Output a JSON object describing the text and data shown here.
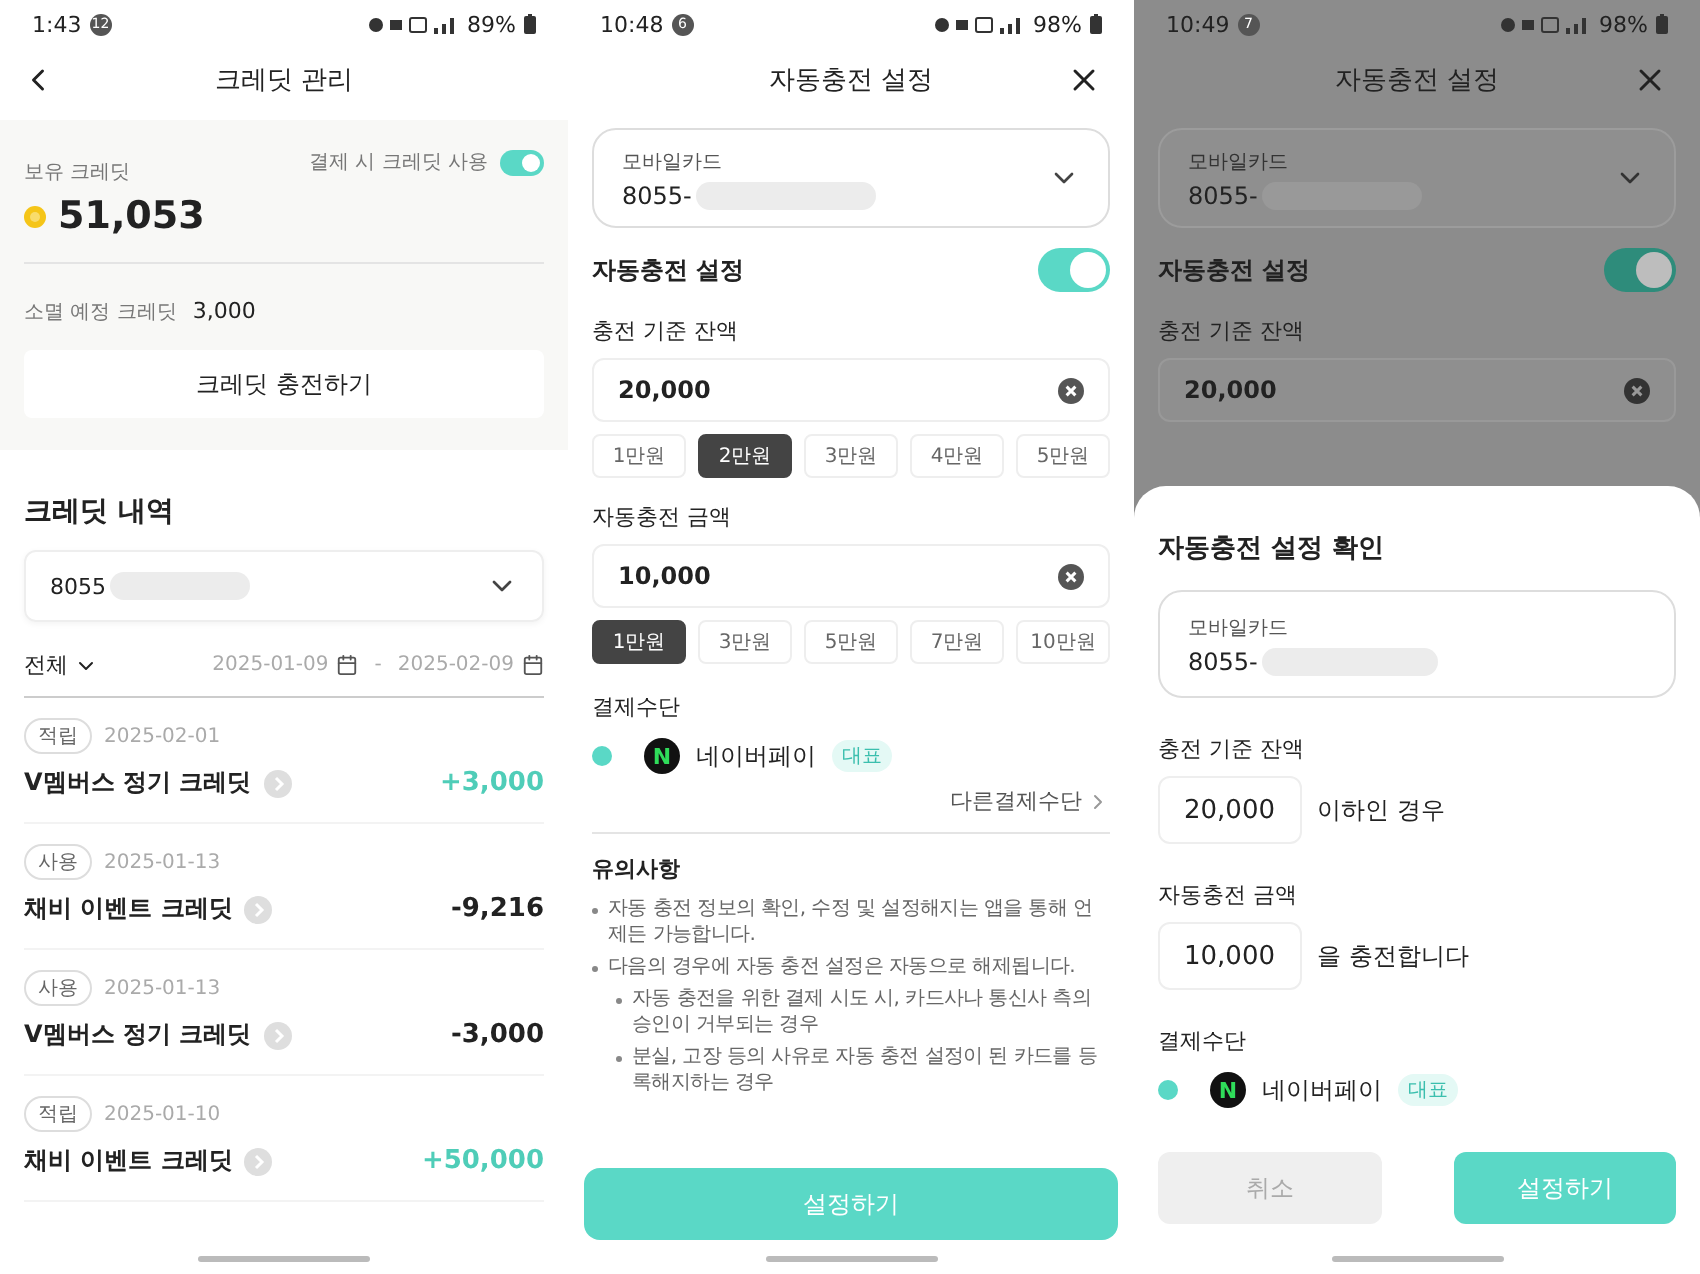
{
  "credit_screen": {
    "status_bar": {
      "time": "1:43",
      "badge": "12",
      "battery": "89%"
    },
    "title": "크레딧 관리",
    "balance_label": "보유 크레딧",
    "balance": "51,053",
    "toggle": {
      "label": "결제 시 크레딧 사용",
      "on": true
    },
    "expiring_label": "소멸 예정 크레딧",
    "expiring_value": "3,000",
    "charge_button": "크레딧 충전하기",
    "history_title": "크레딧 내역",
    "card_select": {
      "value": "8055"
    },
    "filter": "전체",
    "date_from": "2025-01-09",
    "date_separator": "-",
    "date_to": "2025-02-09",
    "transactions": [
      {
        "tag": "적립",
        "date": "2025-02-01",
        "title": "V멤버스 정기 크레딧",
        "amount": "+3,000",
        "kind": "earn"
      },
      {
        "tag": "사용",
        "date": "2025-01-13",
        "title": "채비 이벤트 크레딧",
        "amount": "-9,216",
        "kind": "use"
      },
      {
        "tag": "사용",
        "date": "2025-01-13",
        "title": "V멤버스 정기 크레딧",
        "amount": "-3,000",
        "kind": "use"
      },
      {
        "tag": "적립",
        "date": "2025-01-10",
        "title": "채비 이벤트 크레딧",
        "amount": "+50,000",
        "kind": "earn"
      }
    ]
  },
  "autocharge_screen": {
    "status_bar": {
      "time": "10:48",
      "badge": "6",
      "battery": "98%"
    },
    "title": "자동충전 설정",
    "card": {
      "label": "모바일카드",
      "value": "8055-"
    },
    "toggle": {
      "label": "자동충전 설정",
      "on": true
    },
    "threshold": {
      "label": "충전 기준 잔액",
      "value": "20,000",
      "options": [
        {
          "label": "1만원",
          "selected": false
        },
        {
          "label": "2만원",
          "selected": true
        },
        {
          "label": "3만원",
          "selected": false
        },
        {
          "label": "4만원",
          "selected": false
        },
        {
          "label": "5만원",
          "selected": false
        }
      ]
    },
    "amount": {
      "label": "자동충전 금액",
      "value": "10,000",
      "options": [
        {
          "label": "1만원",
          "selected": true
        },
        {
          "label": "3만원",
          "selected": false
        },
        {
          "label": "5만원",
          "selected": false
        },
        {
          "label": "7만원",
          "selected": false
        },
        {
          "label": "10만원",
          "selected": false
        }
      ]
    },
    "payment": {
      "label": "결제수단",
      "methods": [
        {
          "logo": "N",
          "name": "네이버페이",
          "badge": "대표",
          "selected": true
        }
      ],
      "other_link": "다른결제수단"
    },
    "notes": {
      "title": "유의사항",
      "items": [
        {
          "text": "자동 충전 정보의 확인, 수정 및 설정해지는 앱을 통해 언제든 가능합니다."
        },
        {
          "text": "다음의 경우에 자동 충전 설정은 자동으로 해제됩니다.",
          "children": [
            {
              "text": "자동 충전을 위한 결제 시도 시, 카드사나 통신사 측의 승인이 거부되는 경우"
            },
            {
              "text": "분실, 고장 등의 사유로 자동 충전 설정이 된 카드를 등록해지하는 경우"
            }
          ]
        }
      ]
    },
    "submit": "설정하기"
  },
  "confirm_screen": {
    "status_bar": {
      "time": "10:49",
      "badge": "7",
      "battery": "98%"
    },
    "background": {
      "title": "자동충전 설정",
      "card": {
        "label": "모바일카드",
        "value": "8055-"
      },
      "toggle": {
        "label": "자동충전 설정",
        "on": true
      },
      "threshold_label": "충전 기준 잔액",
      "threshold_value": "20,000"
    },
    "sheet": {
      "title": "자동충전 설정 확인",
      "card": {
        "label": "모바일카드",
        "value": "8055-"
      },
      "threshold": {
        "label": "충전 기준 잔액",
        "value": "20,000",
        "suffix": "이하인 경우"
      },
      "amount": {
        "label": "자동충전 금액",
        "value": "10,000",
        "suffix": "을 충전합니다"
      },
      "payment": {
        "label": "결제수단",
        "methods": [
          {
            "logo": "N",
            "name": "네이버페이",
            "badge": "대표",
            "selected": true
          }
        ]
      },
      "cancel": "취소",
      "submit": "설정하기"
    }
  }
}
